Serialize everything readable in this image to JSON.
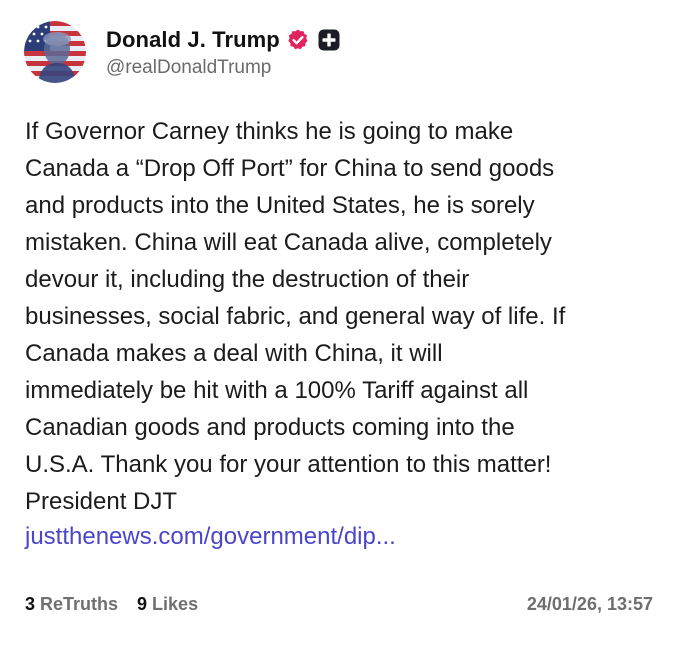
{
  "author": {
    "display_name": "Donald J. Trump",
    "handle": "@realDonaldTrump",
    "verified_badge_color": "#e0245e",
    "verified_icon": "verified-badge-icon",
    "plus_icon": "plus-square-icon",
    "avatar_icon": "flag-portrait-avatar"
  },
  "post": {
    "body": "If Governor Carney thinks he is going to make\nCanada a “Drop Off Port” for China to send goods\nand products into the United States, he is sorely\nmistaken. China will eat Canada alive, completely\ndevour it, including the destruction of their\nbusinesses, social fabric, and general way of life. If\nCanada makes a deal with China, it will\nimmediately be hit with a 100% Tariff against all\nCanadian goods and products coming into the\nU.S.A. Thank you for your attention to this matter!\nPresident DJT",
    "link_text": "justthenews.com/government/dip...",
    "link_color": "#4b45c9"
  },
  "stats": {
    "retruths_count": "3",
    "retruths_label": "ReTruths",
    "likes_count": "9",
    "likes_label": "Likes"
  },
  "timestamp": "24/01/26, 13:57"
}
